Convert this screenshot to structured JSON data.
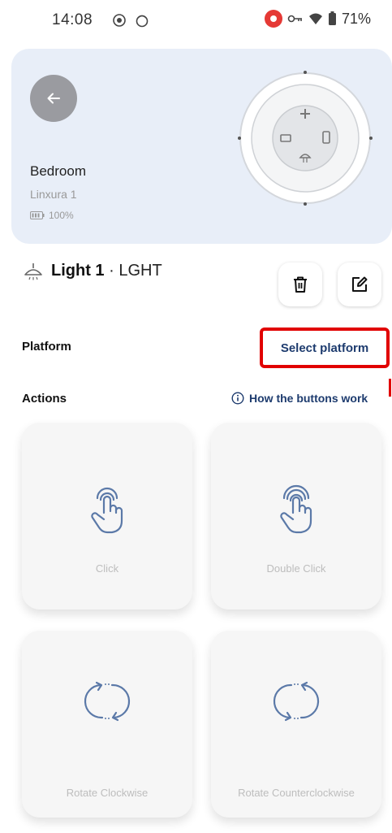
{
  "status_bar": {
    "time": "14:08",
    "battery": "71%"
  },
  "device": {
    "name": "Bedroom",
    "model": "Linxura 1",
    "battery": "100%"
  },
  "light": {
    "title": "Light 1",
    "separator": "·",
    "type": "LGHT"
  },
  "platform": {
    "label": "Platform",
    "select_label": "Select platform"
  },
  "actions": {
    "label": "Actions",
    "help_link": "How the buttons work",
    "items": [
      {
        "label": "Click",
        "icon": "tap-icon"
      },
      {
        "label": "Double Click",
        "icon": "double-tap-icon"
      },
      {
        "label": "Rotate Clockwise",
        "icon": "rotate-clockwise-icon"
      },
      {
        "label": "Rotate Counterclockwise",
        "icon": "rotate-counterclockwise-icon"
      }
    ]
  },
  "colors": {
    "card_bg": "#e8eef8",
    "accent": "#1d3b6e",
    "highlight": "#e10000",
    "icon": "#5b79a8"
  }
}
